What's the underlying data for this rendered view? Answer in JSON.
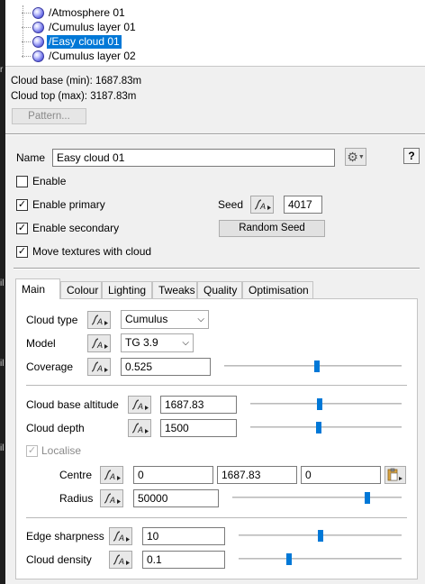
{
  "edge_marks": [
    "r",
    "il",
    "il",
    "il"
  ],
  "tree": {
    "items": [
      {
        "label": "/Atmosphere 01",
        "selected": false
      },
      {
        "label": "/Cumulus layer 01",
        "selected": false
      },
      {
        "label": "/Easy cloud 01",
        "selected": true
      },
      {
        "label": "/Cumulus layer 02",
        "selected": false
      }
    ]
  },
  "info": {
    "cloud_base": "Cloud base (min): 1687.83m",
    "cloud_top": "Cloud top (max): 3187.83m",
    "pattern_button": "Pattern..."
  },
  "header": {
    "name_label": "Name",
    "name_value": "Easy cloud 01",
    "help_label": "?",
    "enable_label": "Enable",
    "enable_checked": false,
    "enable_primary_label": "Enable primary",
    "enable_primary_checked": true,
    "enable_secondary_label": "Enable secondary",
    "enable_secondary_checked": true,
    "move_textures_label": "Move textures with cloud",
    "move_textures_checked": true,
    "seed_label": "Seed",
    "seed_value": "4017",
    "random_seed_button": "Random Seed"
  },
  "tabs": [
    "Main",
    "Colour",
    "Lighting",
    "Tweaks",
    "Quality",
    "Optimisation"
  ],
  "active_tab": "Main",
  "main": {
    "cloud_type": {
      "label": "Cloud type",
      "value": "Cumulus"
    },
    "model": {
      "label": "Model",
      "value": "TG 3.9"
    },
    "coverage": {
      "label": "Coverage",
      "value": "0.525",
      "slider": 0.525
    },
    "base_altitude": {
      "label": "Cloud base altitude",
      "value": "1687.83",
      "slider": 0.46
    },
    "depth": {
      "label": "Cloud depth",
      "value": "1500",
      "slider": 0.45
    },
    "localise": {
      "label": "Localise",
      "checked": true,
      "disabled": true
    },
    "centre": {
      "label": "Centre",
      "x": "0",
      "y": "1687.83",
      "z": "0"
    },
    "radius": {
      "label": "Radius",
      "value": "50000",
      "slider": 0.8
    },
    "edge_sharpness": {
      "label": "Edge sharpness",
      "value": "10",
      "slider": 0.5
    },
    "cloud_density": {
      "label": "Cloud density",
      "value": "0.1",
      "slider": 0.31
    }
  },
  "colors": {
    "selection": "#0078d7",
    "slider_thumb": "#0078d7"
  }
}
